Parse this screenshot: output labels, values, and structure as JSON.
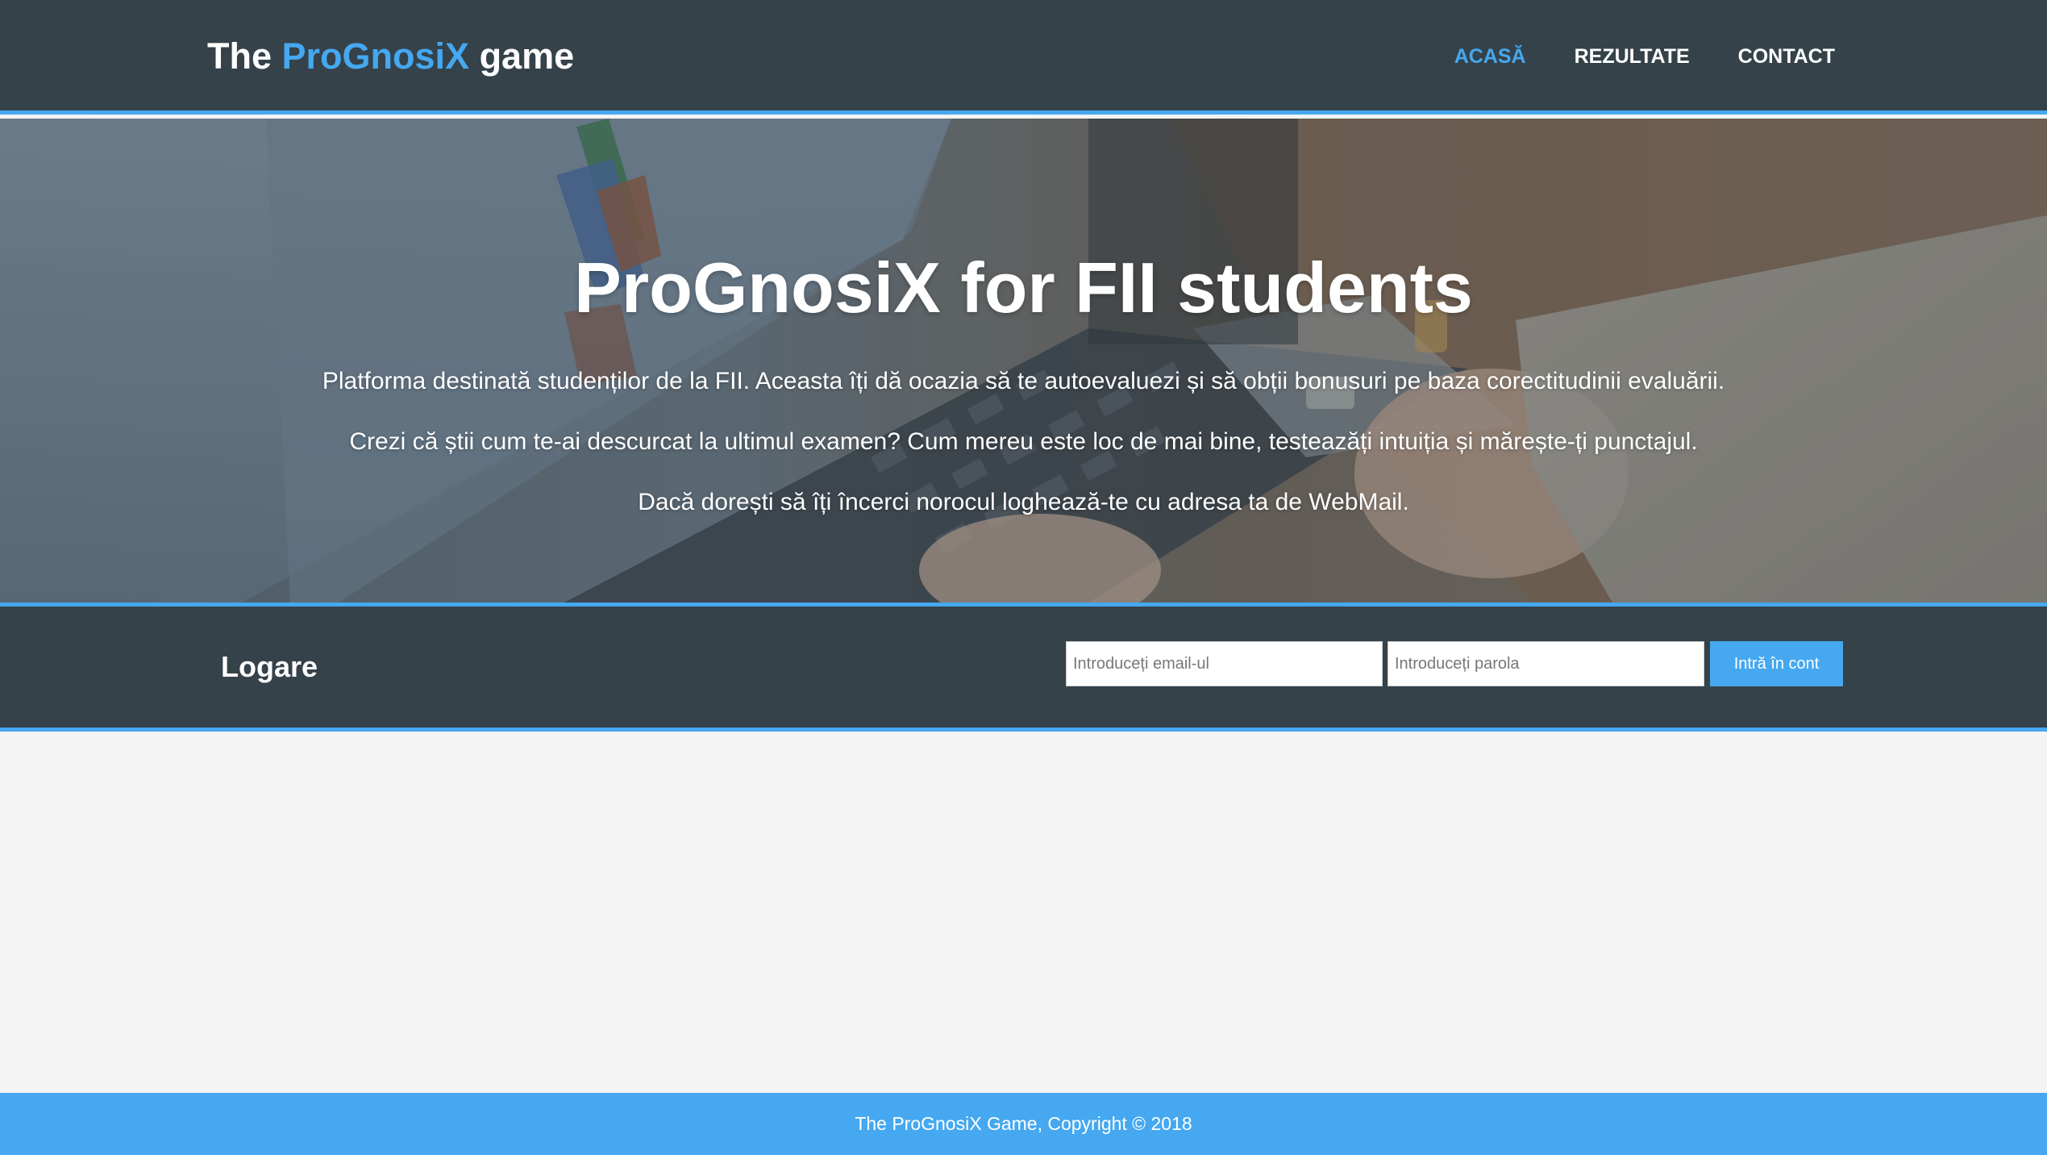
{
  "header": {
    "logo_prefix": "The ",
    "logo_highlight": "ProGnosiX",
    "logo_suffix": " game",
    "nav": [
      {
        "label": "ACASĂ",
        "active": true
      },
      {
        "label": "REZULTATE",
        "active": false
      },
      {
        "label": "CONTACT",
        "active": false
      }
    ]
  },
  "hero": {
    "title": "ProGnosiX for FII students",
    "paragraphs": [
      "Platforma destinată studenților de la FII. Aceasta îți dă ocazia să te autoevaluezi și să obții bonusuri pe baza corectitudinii evaluării.",
      "Crezi că știi cum te-ai descurcat la ultimul examen? Cum mereu este loc de mai bine, testeazăți intuiția și mărește-ți punctajul.",
      "Dacă dorești să îți încerci norocul loghează-te cu adresa ta de WebMail."
    ]
  },
  "login": {
    "title": "Logare",
    "email_placeholder": "Introduceți email-ul",
    "email_value": "",
    "password_placeholder": "Introduceți parola",
    "password_value": "",
    "submit_label": "Intră în cont"
  },
  "footer": {
    "text": "The ProGnosiX Game, Copyright © 2018"
  },
  "colors": {
    "primary_dark": "#35424a",
    "accent_blue": "#45a8f0",
    "background": "#f4f4f4",
    "text_light": "#ffffff"
  }
}
